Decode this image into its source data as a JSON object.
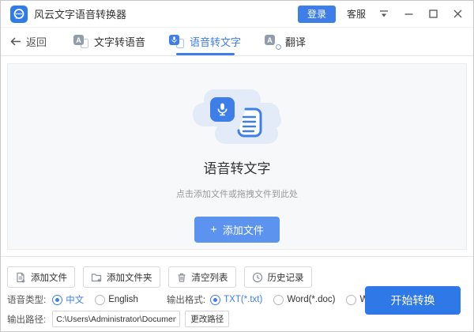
{
  "window": {
    "title": "风云文字语音转换器"
  },
  "titlebar": {
    "login_label": "登录",
    "support_label": "客服"
  },
  "tabbar": {
    "back_label": "返回",
    "tabs": [
      {
        "label": "文字转语音",
        "active": false
      },
      {
        "label": "语音转文字",
        "active": true
      },
      {
        "label": "翻译",
        "active": false
      }
    ]
  },
  "dropzone": {
    "title": "语音转文字",
    "hint": "点击添加文件或拖拽文件到此处",
    "add_plus": "+",
    "add_file_label": "添加文件"
  },
  "toolbar": {
    "buttons": [
      {
        "label": "添加文件",
        "icon": "file-plus-icon"
      },
      {
        "label": "添加文件夹",
        "icon": "folder-plus-icon"
      },
      {
        "label": "清空列表",
        "icon": "trash-icon"
      },
      {
        "label": "历史记录",
        "icon": "clock-icon"
      }
    ]
  },
  "options": {
    "voice_type_label": "语音类型:",
    "voice_types": [
      {
        "label": "中文",
        "selected": true
      },
      {
        "label": "English",
        "selected": false
      }
    ],
    "format_label": "输出格式:",
    "formats": [
      {
        "label": "TXT(*.txt)",
        "selected": true
      },
      {
        "label": "Word(*.doc)",
        "selected": false
      },
      {
        "label": "Word(*.docx)",
        "selected": false
      }
    ]
  },
  "output_path": {
    "label": "输出路径:",
    "value": "C:\\Users\\Administrator\\Documents\\风云文字语音转换器",
    "change_button_label": "更改路径"
  },
  "start_button_label": "开始转换",
  "icons": {
    "tab_text_glyph": "A",
    "tab_translate_glyph": "A",
    "logo": "chat-bubble-logo",
    "menu": "menu-caret-icon"
  },
  "colors": {
    "accent_blue": "#3D7EE8",
    "add_button_blue": "#5B93EE",
    "start_button_blue": "#2E78E8",
    "cloud_blue": "#E3EBF8",
    "dropzone_bg": "#F7F8FA"
  }
}
